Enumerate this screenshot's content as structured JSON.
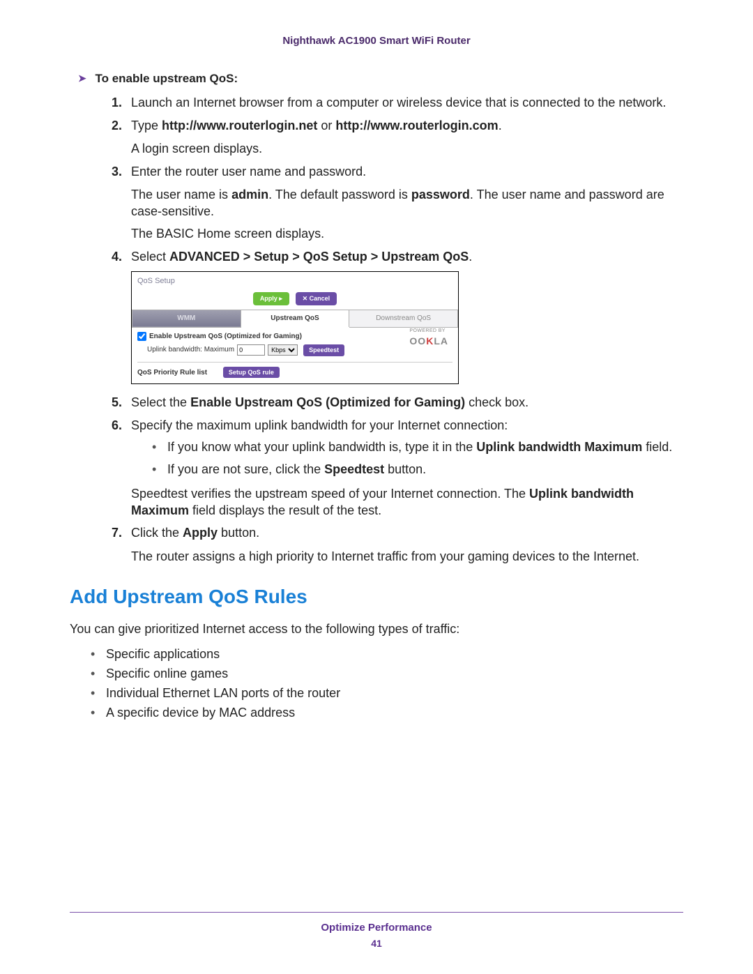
{
  "header": {
    "title": "Nighthawk AC1900 Smart WiFi Router"
  },
  "enable": {
    "lead": "To enable upstream QoS:"
  },
  "steps": [
    {
      "html": "Launch an Internet browser from a computer or wireless device that is connected to the network."
    },
    {
      "html": "Type <b>http://www.routerlogin.net</b> or <b>http://www.routerlogin.com</b>.",
      "after": [
        "A login screen displays."
      ]
    },
    {
      "html": "Enter the router user name and password.",
      "after": [
        "The user name is <b>admin</b>. The default password is <b>password</b>. The user name and password are case-sensitive.",
        "The BASIC Home screen displays."
      ]
    },
    {
      "html": "Select <b>ADVANCED > Setup > QoS Setup > Upstream QoS</b>.",
      "screenshot": true
    },
    {
      "html": "Select the <b>Enable Upstream QoS (Optimized for Gaming)</b> check box."
    },
    {
      "html": "Specify the maximum uplink bandwidth for your Internet connection:",
      "subs": [
        "If you know what your uplink bandwidth is, type it in the <b>Uplink bandwidth Maximum</b> field.",
        "If you are not sure, click the <b>Speedtest</b> button."
      ],
      "after": [
        "Speedtest verifies the upstream speed of your Internet connection. The <b>Uplink bandwidth Maximum</b> field displays the result of the test."
      ]
    },
    {
      "html": "Click the <b>Apply</b> button.",
      "after": [
        "The router assigns a high priority to Internet traffic from your gaming devices to the Internet."
      ]
    }
  ],
  "shot": {
    "title": "QoS Setup",
    "apply": "Apply ▸",
    "cancel": "✕ Cancel",
    "tabs": {
      "wmm": "WMM",
      "up": "Upstream QoS",
      "down": "Downstream QoS"
    },
    "check_label": "Enable Upstream QoS (Optimized for Gaming)",
    "uplink_label": "Uplink bandwidth: Maximum",
    "uplink_value": "0",
    "unit": "Kbps",
    "speedtest": "Speedtest",
    "powered": "POWERED BY",
    "rule_label": "QoS Priority Rule list",
    "setup_rule": "Setup QoS rule"
  },
  "section": {
    "heading": "Add Upstream QoS Rules",
    "intro": "You can give prioritized Internet access to the following types of traffic:",
    "items": [
      "Specific applications",
      "Specific online games",
      "Individual Ethernet LAN ports of the router",
      "A specific device by MAC address"
    ]
  },
  "footer": {
    "label": "Optimize Performance",
    "page": "41"
  }
}
